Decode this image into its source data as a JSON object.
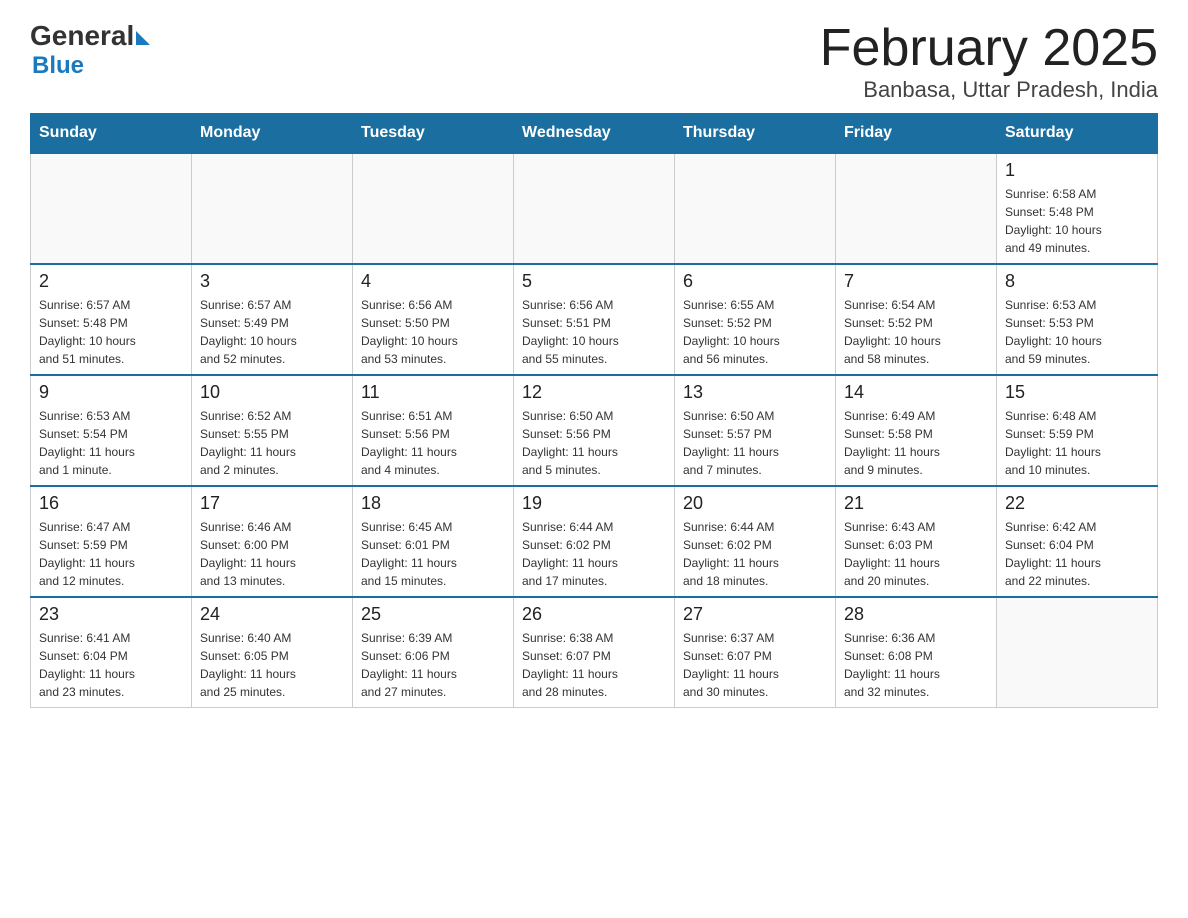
{
  "logo": {
    "general": "General",
    "blue": "Blue"
  },
  "title": "February 2025",
  "subtitle": "Banbasa, Uttar Pradesh, India",
  "days_of_week": [
    "Sunday",
    "Monday",
    "Tuesday",
    "Wednesday",
    "Thursday",
    "Friday",
    "Saturday"
  ],
  "weeks": [
    [
      {
        "day": "",
        "info": ""
      },
      {
        "day": "",
        "info": ""
      },
      {
        "day": "",
        "info": ""
      },
      {
        "day": "",
        "info": ""
      },
      {
        "day": "",
        "info": ""
      },
      {
        "day": "",
        "info": ""
      },
      {
        "day": "1",
        "info": "Sunrise: 6:58 AM\nSunset: 5:48 PM\nDaylight: 10 hours\nand 49 minutes."
      }
    ],
    [
      {
        "day": "2",
        "info": "Sunrise: 6:57 AM\nSunset: 5:48 PM\nDaylight: 10 hours\nand 51 minutes."
      },
      {
        "day": "3",
        "info": "Sunrise: 6:57 AM\nSunset: 5:49 PM\nDaylight: 10 hours\nand 52 minutes."
      },
      {
        "day": "4",
        "info": "Sunrise: 6:56 AM\nSunset: 5:50 PM\nDaylight: 10 hours\nand 53 minutes."
      },
      {
        "day": "5",
        "info": "Sunrise: 6:56 AM\nSunset: 5:51 PM\nDaylight: 10 hours\nand 55 minutes."
      },
      {
        "day": "6",
        "info": "Sunrise: 6:55 AM\nSunset: 5:52 PM\nDaylight: 10 hours\nand 56 minutes."
      },
      {
        "day": "7",
        "info": "Sunrise: 6:54 AM\nSunset: 5:52 PM\nDaylight: 10 hours\nand 58 minutes."
      },
      {
        "day": "8",
        "info": "Sunrise: 6:53 AM\nSunset: 5:53 PM\nDaylight: 10 hours\nand 59 minutes."
      }
    ],
    [
      {
        "day": "9",
        "info": "Sunrise: 6:53 AM\nSunset: 5:54 PM\nDaylight: 11 hours\nand 1 minute."
      },
      {
        "day": "10",
        "info": "Sunrise: 6:52 AM\nSunset: 5:55 PM\nDaylight: 11 hours\nand 2 minutes."
      },
      {
        "day": "11",
        "info": "Sunrise: 6:51 AM\nSunset: 5:56 PM\nDaylight: 11 hours\nand 4 minutes."
      },
      {
        "day": "12",
        "info": "Sunrise: 6:50 AM\nSunset: 5:56 PM\nDaylight: 11 hours\nand 5 minutes."
      },
      {
        "day": "13",
        "info": "Sunrise: 6:50 AM\nSunset: 5:57 PM\nDaylight: 11 hours\nand 7 minutes."
      },
      {
        "day": "14",
        "info": "Sunrise: 6:49 AM\nSunset: 5:58 PM\nDaylight: 11 hours\nand 9 minutes."
      },
      {
        "day": "15",
        "info": "Sunrise: 6:48 AM\nSunset: 5:59 PM\nDaylight: 11 hours\nand 10 minutes."
      }
    ],
    [
      {
        "day": "16",
        "info": "Sunrise: 6:47 AM\nSunset: 5:59 PM\nDaylight: 11 hours\nand 12 minutes."
      },
      {
        "day": "17",
        "info": "Sunrise: 6:46 AM\nSunset: 6:00 PM\nDaylight: 11 hours\nand 13 minutes."
      },
      {
        "day": "18",
        "info": "Sunrise: 6:45 AM\nSunset: 6:01 PM\nDaylight: 11 hours\nand 15 minutes."
      },
      {
        "day": "19",
        "info": "Sunrise: 6:44 AM\nSunset: 6:02 PM\nDaylight: 11 hours\nand 17 minutes."
      },
      {
        "day": "20",
        "info": "Sunrise: 6:44 AM\nSunset: 6:02 PM\nDaylight: 11 hours\nand 18 minutes."
      },
      {
        "day": "21",
        "info": "Sunrise: 6:43 AM\nSunset: 6:03 PM\nDaylight: 11 hours\nand 20 minutes."
      },
      {
        "day": "22",
        "info": "Sunrise: 6:42 AM\nSunset: 6:04 PM\nDaylight: 11 hours\nand 22 minutes."
      }
    ],
    [
      {
        "day": "23",
        "info": "Sunrise: 6:41 AM\nSunset: 6:04 PM\nDaylight: 11 hours\nand 23 minutes."
      },
      {
        "day": "24",
        "info": "Sunrise: 6:40 AM\nSunset: 6:05 PM\nDaylight: 11 hours\nand 25 minutes."
      },
      {
        "day": "25",
        "info": "Sunrise: 6:39 AM\nSunset: 6:06 PM\nDaylight: 11 hours\nand 27 minutes."
      },
      {
        "day": "26",
        "info": "Sunrise: 6:38 AM\nSunset: 6:07 PM\nDaylight: 11 hours\nand 28 minutes."
      },
      {
        "day": "27",
        "info": "Sunrise: 6:37 AM\nSunset: 6:07 PM\nDaylight: 11 hours\nand 30 minutes."
      },
      {
        "day": "28",
        "info": "Sunrise: 6:36 AM\nSunset: 6:08 PM\nDaylight: 11 hours\nand 32 minutes."
      },
      {
        "day": "",
        "info": ""
      }
    ]
  ]
}
